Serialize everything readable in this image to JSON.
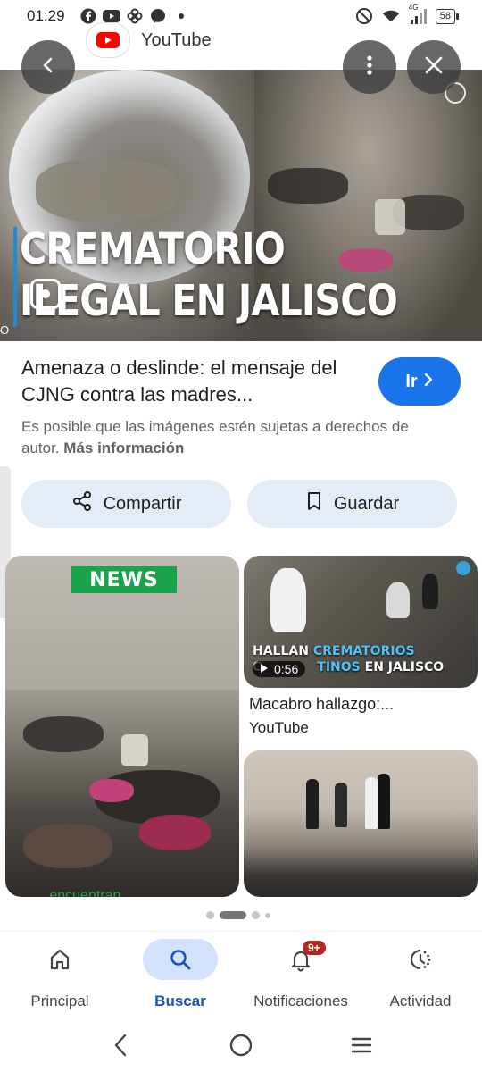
{
  "status_bar": {
    "time": "01:29",
    "left_icons": [
      "facebook-icon",
      "youtube-icon",
      "pinwheel-icon",
      "messenger-icon",
      "dot-icon"
    ],
    "right_icons": [
      "dnd-icon",
      "wifi-icon",
      "signal-4g-icon"
    ],
    "network": "4G",
    "battery": "58"
  },
  "source": {
    "name": "YouTube"
  },
  "hero": {
    "title_line1": "CREMATORIO",
    "title_line2": "ILEGAL EN JALISCO",
    "edge_text": "O"
  },
  "result": {
    "title": "Amenaza o deslinde: el mensaje del CJNG contra las madres...",
    "go_label": "Ir",
    "copyright_text": "Es posible que las imágenes estén sujetas a derechos de autor.",
    "more_info": "Más información",
    "share_label": "Compartir",
    "save_label": "Guardar"
  },
  "grid": {
    "card_a": {
      "logo": "NEWS",
      "caption": "...encuentran..."
    },
    "card_b": {
      "overlay_line1_a": "HALLAN",
      "overlay_line1_b": "CREMATORIOS",
      "overlay_line2_a": "C",
      "overlay_line2_b": "TINOS",
      "overlay_line2_c": "EN JALISCO",
      "duration": "0:56",
      "title": "Macabro hallazgo:...",
      "source": "YouTube"
    }
  },
  "pager": {
    "active_index": 1,
    "count": 4
  },
  "bottom_nav": {
    "items": [
      {
        "label": "Principal",
        "icon": "home-icon"
      },
      {
        "label": "Buscar",
        "icon": "search-icon"
      },
      {
        "label": "Notificaciones",
        "icon": "bell-icon",
        "badge": "9+"
      },
      {
        "label": "Actividad",
        "icon": "activity-icon"
      }
    ],
    "active": "Buscar"
  },
  "colors": {
    "accent": "#1a73e8",
    "pill_bg": "#e4ecf7",
    "nav_active_bg": "#d3e3fd",
    "badge": "#b3261e"
  }
}
